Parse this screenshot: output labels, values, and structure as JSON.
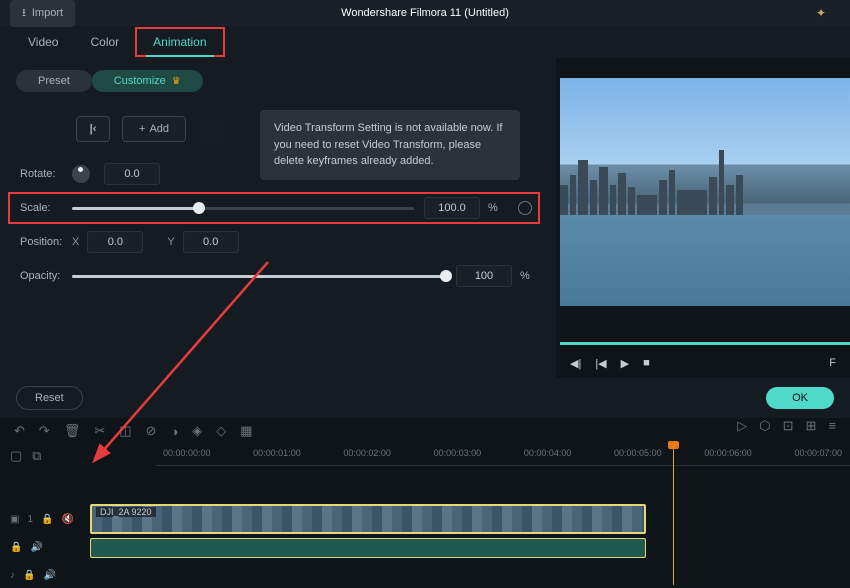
{
  "topbar": {
    "import_label": "Import",
    "title": "Wondershare Filmora 11 (Untitled)"
  },
  "tabs": {
    "video": "Video",
    "color": "Color",
    "animation": "Animation"
  },
  "pills": {
    "preset": "Preset",
    "customize": "Customize"
  },
  "kf": {
    "jump_label": "|‹",
    "add_label": "Add",
    "tooltip": "Video Transform Setting is not available now. If you need to reset Video Transform, please delete keyframes already added."
  },
  "props": {
    "rotate_label": "Rotate:",
    "rotate_val": "0.0",
    "scale_label": "Scale:",
    "scale_val": "100.0",
    "scale_unit": "%",
    "position_label": "Position:",
    "pos_x_label": "X",
    "pos_x_val": "0.0",
    "pos_y_label": "Y",
    "pos_y_val": "0.0",
    "opacity_label": "Opacity:",
    "opacity_val": "100",
    "opacity_unit": "%"
  },
  "actions": {
    "reset": "Reset",
    "ok": "OK"
  },
  "playback": {
    "fullscreen_label": "F"
  },
  "timeline": {
    "ticks": [
      "00:00:00:00",
      "00:00:01:00",
      "00:00:02:00",
      "00:00:03:00",
      "00:00:04:00",
      "00:00:05:00",
      "00:00:06:00",
      "00:00:07:00"
    ],
    "track1_label": "1",
    "clip_name": "DJI_2A 9220"
  }
}
